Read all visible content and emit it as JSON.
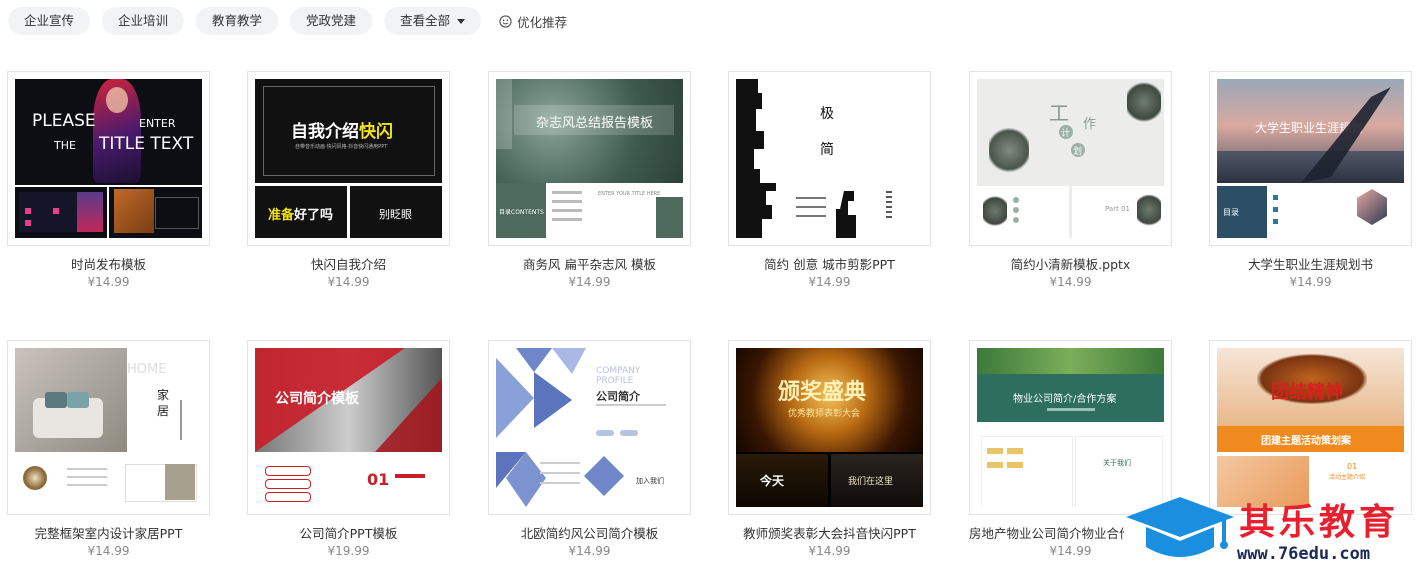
{
  "filters": {
    "tags": [
      "企业宣传",
      "企业培训",
      "教育教学",
      "党政党建"
    ],
    "view_all": "查看全部",
    "optimize": "优化推荐"
  },
  "templates": [
    {
      "title": "时尚发布模板",
      "price": "¥14.99"
    },
    {
      "title": "快闪自我介绍",
      "price": "¥14.99"
    },
    {
      "title": "商务风 扁平杂志风 模板",
      "price": "¥14.99"
    },
    {
      "title": "简约 创意 城市剪影PPT",
      "price": "¥14.99"
    },
    {
      "title": "简约小清新模板.pptx",
      "price": "¥14.99"
    },
    {
      "title": "大学生职业生涯规划书",
      "price": "¥14.99"
    },
    {
      "title": "完整框架室内设计家居PPT",
      "price": "¥14.99"
    },
    {
      "title": "公司简介PPT模板",
      "price": "¥19.99"
    },
    {
      "title": "北欧简约风公司简介模板",
      "price": "¥14.99"
    },
    {
      "title": "教师颁奖表彰大会抖音快闪PPT",
      "price": "¥14.99"
    },
    {
      "title": "房地产物业公司简介物业合作方案",
      "price": "¥14.99"
    },
    {
      "title": "",
      "price": ""
    }
  ],
  "thumbs": {
    "t1": {
      "l1": "PLEASE",
      "l2": "ENTER",
      "l3": "THE",
      "l4": "TITLE TEXT"
    },
    "t2": {
      "main_a": "自我介绍",
      "main_b": "快闪",
      "sub": "自带音乐动画·快闪风格·抖音快闪通用PPT",
      "btn1_a": "准备",
      "btn1_b": "好了吗",
      "btn2": "别眨眼"
    },
    "t3": {
      "title": "杂志风总结报告模板",
      "enter": "ENTER YOUR TITLE HERE",
      "contents": "目录CONTENTS"
    },
    "t4": {
      "c1": "极",
      "c2": "简"
    },
    "t5": {
      "c1": "工",
      "c2": "作",
      "c3": "计",
      "c4": "划",
      "part": "Part 01"
    },
    "t6": {
      "title": "大学生职业生涯规划",
      "catalog": "目录"
    },
    "t7": {
      "home": "HOME",
      "c1": "家",
      "c2": "居"
    },
    "t8": {
      "title": "公司简介模板",
      "num": "01"
    },
    "t9": {
      "en1": "COMPANY",
      "en2": "PROFILE",
      "cn": "公司简介",
      "join": "加入我们"
    },
    "t10": {
      "title": "颁奖盛典",
      "sub": "优秀教师表彰大会",
      "jin": "今天",
      "w": "我们在这里"
    },
    "t11": {
      "title": "物业公司简介/合作方案",
      "about": "关于我们"
    },
    "t12": {
      "banner": "团结精神",
      "title": "团建主题活动策划案",
      "n": "01",
      "sub": "活动主题介绍"
    }
  },
  "watermark": {
    "brand": "其乐教育",
    "url": "www.76edu.com"
  },
  "colors": {
    "chip_bg": "#f2f3f5",
    "accent_red": "#e8202e",
    "brand_blue": "#1a8fe0",
    "price": "#888888"
  }
}
